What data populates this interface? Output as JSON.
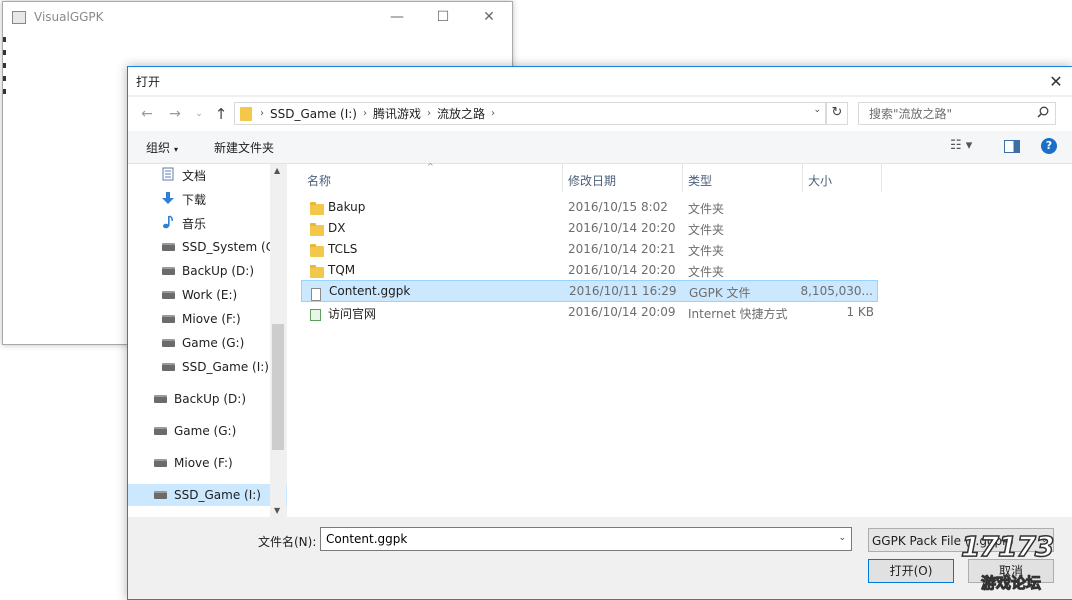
{
  "background_window": {
    "title": "VisualGGPK",
    "min_glyph": "—",
    "max_glyph": "☐",
    "close_glyph": "✕"
  },
  "dialog": {
    "title": "打开",
    "close_glyph": "✕"
  },
  "nav": {
    "back": "←",
    "forward": "→",
    "recent": "⌄",
    "up": "↑"
  },
  "address": {
    "crumbs": [
      "SSD_Game (I:)",
      "腾讯游戏",
      "流放之路"
    ],
    "separator": "›",
    "dropdown": "⌄",
    "refresh": "↻"
  },
  "search": {
    "placeholder": "搜索\"流放之路\"",
    "icon": "search-icon"
  },
  "toolbar": {
    "organize_label": "组织",
    "organize_caret": "▾",
    "new_folder_label": "新建文件夹",
    "view_glyph": "☷ ▾",
    "help_glyph": "?"
  },
  "sidebar": {
    "items": [
      {
        "label": "文档",
        "icon": "document-icon"
      },
      {
        "label": "下载",
        "icon": "download-icon"
      },
      {
        "label": "音乐",
        "icon": "music-icon"
      },
      {
        "label": "SSD_System (C:)",
        "icon": "drive-icon"
      },
      {
        "label": "BackUp (D:)",
        "icon": "drive-icon"
      },
      {
        "label": "Work (E:)",
        "icon": "drive-icon"
      },
      {
        "label": "Miove (F:)",
        "icon": "drive-icon"
      },
      {
        "label": "Game (G:)",
        "icon": "drive-icon"
      },
      {
        "label": "SSD_Game (I:)",
        "icon": "drive-icon"
      },
      {
        "label": "BackUp (D:)",
        "icon": "drive-icon"
      },
      {
        "label": "Game (G:)",
        "icon": "drive-icon"
      },
      {
        "label": "Miove (F:)",
        "icon": "drive-icon"
      },
      {
        "label": "SSD_Game (I:)",
        "icon": "drive-icon",
        "selected": true
      }
    ],
    "scroll_up": "▲",
    "scroll_down": "▼"
  },
  "columns": {
    "name": "名称",
    "date": "修改日期",
    "type": "类型",
    "size": "大小",
    "sort_arrow": "^"
  },
  "files": [
    {
      "name": "Bakup",
      "date": "2016/10/15 8:02",
      "type": "文件夹",
      "size": "",
      "icon": "folder-icon"
    },
    {
      "name": "DX",
      "date": "2016/10/14 20:20",
      "type": "文件夹",
      "size": "",
      "icon": "folder-icon"
    },
    {
      "name": "TCLS",
      "date": "2016/10/14 20:21",
      "type": "文件夹",
      "size": "",
      "icon": "folder-icon"
    },
    {
      "name": "TQM",
      "date": "2016/10/14 20:20",
      "type": "文件夹",
      "size": "",
      "icon": "folder-icon"
    },
    {
      "name": "Content.ggpk",
      "date": "2016/10/11 16:29",
      "type": "GGPK 文件",
      "size": "8,105,030...",
      "icon": "file-icon",
      "selected": true
    },
    {
      "name": "访问官网",
      "date": "2016/10/14 20:09",
      "type": "Internet 快捷方式",
      "size": "1 KB",
      "icon": "shortcut-icon"
    }
  ],
  "bottom": {
    "filename_label": "文件名(N):",
    "filename_value": "Content.ggpk",
    "filename_dropdown": "⌄",
    "filetype_value": "GGPK Pack File (*.ggpk)",
    "filetype_dropdown": "⌄",
    "open_label": "打开(O)",
    "cancel_label": "取消"
  },
  "watermark": {
    "big": "17173",
    "small": "游戏论坛"
  },
  "colors": {
    "accent": "#0078d7",
    "selection": "#cce8ff",
    "folder": "#f3c74a"
  }
}
